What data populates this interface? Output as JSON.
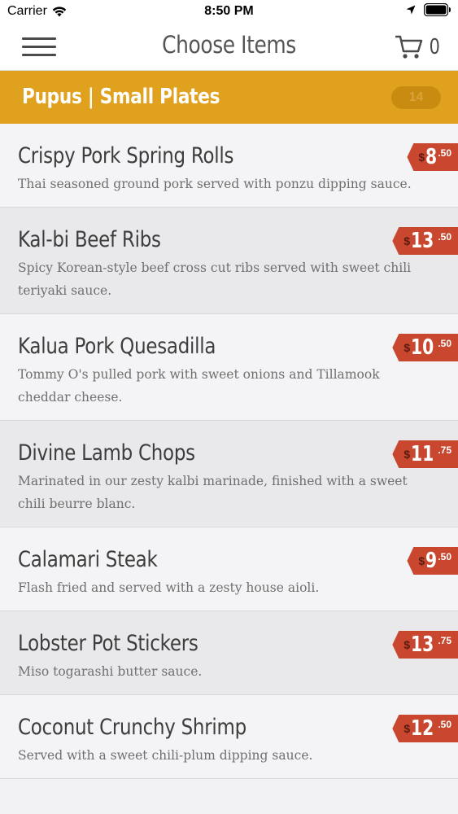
{
  "status_bar": {
    "carrier": "Carrier",
    "time": "8:50 PM"
  },
  "nav": {
    "title": "Choose Items",
    "cart_count": "0"
  },
  "category": {
    "name": "Pupus | Small Plates",
    "count": "14"
  },
  "items": [
    {
      "name": "Crispy Pork Spring Rolls",
      "desc": "Thai seasoned ground pork served with ponzu dipping sauce.",
      "currency": "$",
      "dollars": "8",
      "cents": ".50"
    },
    {
      "name": "Kal-bi Beef Ribs",
      "desc": "Spicy Korean-style beef cross cut ribs served with sweet chili teriyaki sauce.",
      "currency": "$",
      "dollars": "13",
      "cents": ".50"
    },
    {
      "name": "Kalua Pork Quesadilla",
      "desc": "Tommy O's pulled pork with sweet onions and Tillamook cheddar cheese.",
      "currency": "$",
      "dollars": "10",
      "cents": ".50"
    },
    {
      "name": "Divine Lamb Chops",
      "desc": "Marinated in our zesty kalbi marinade, finished with a sweet chili beurre blanc.",
      "currency": "$",
      "dollars": "11",
      "cents": ".75"
    },
    {
      "name": "Calamari Steak",
      "desc": "Flash fried and served with a zesty house aioli.",
      "currency": "$",
      "dollars": "9",
      "cents": ".50"
    },
    {
      "name": "Lobster Pot Stickers",
      "desc": "Miso togarashi butter sauce.",
      "currency": "$",
      "dollars": "13",
      "cents": ".75"
    },
    {
      "name": "Coconut Crunchy Shrimp",
      "desc": "Served with a sweet chili-plum dipping sauce.",
      "currency": "$",
      "dollars": "12",
      "cents": ".50"
    }
  ]
}
